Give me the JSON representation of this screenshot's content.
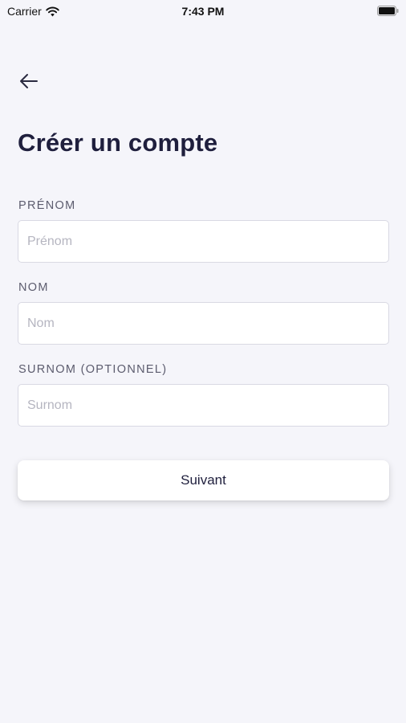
{
  "status_bar": {
    "carrier": "Carrier",
    "time": "7:43 PM"
  },
  "header": {
    "back_icon": "arrow-left-icon",
    "title": "Créer un compte"
  },
  "form": {
    "first_name": {
      "label": "PRÉNOM",
      "placeholder": "Prénom",
      "value": ""
    },
    "last_name": {
      "label": "NOM",
      "placeholder": "Nom",
      "value": ""
    },
    "nickname": {
      "label": "SURNOM (OPTIONNEL)",
      "placeholder": "Surnom",
      "value": ""
    }
  },
  "actions": {
    "next_label": "Suivant"
  },
  "colors": {
    "background": "#f5f5fa",
    "title": "#1f1f3d",
    "label": "#5c5c6e",
    "input_border": "#d9d9e3",
    "placeholder": "#b5b5c0"
  }
}
